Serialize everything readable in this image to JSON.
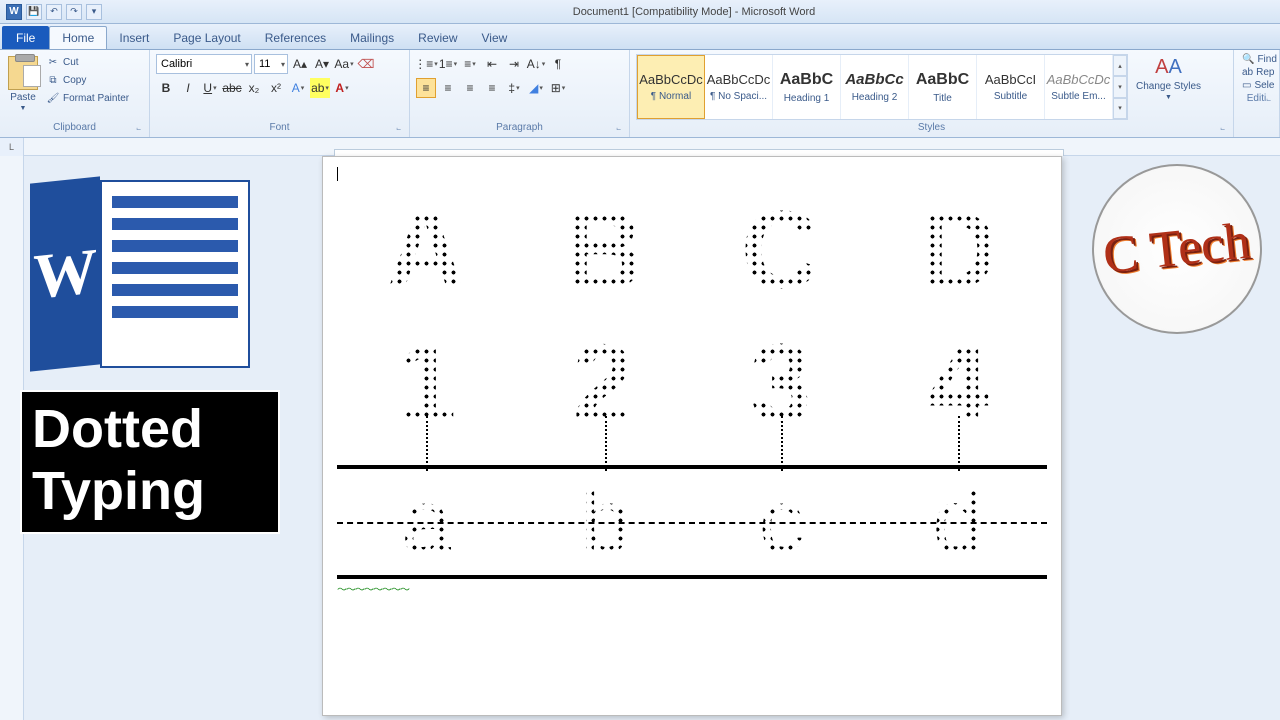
{
  "titlebar": {
    "title": "Document1 [Compatibility Mode] - Microsoft Word"
  },
  "tabs": {
    "file": "File",
    "items": [
      "Home",
      "Insert",
      "Page Layout",
      "References",
      "Mailings",
      "Review",
      "View"
    ],
    "active": "Home"
  },
  "clipboard": {
    "paste": "Paste",
    "cut": "Cut",
    "copy": "Copy",
    "fmt": "Format Painter",
    "label": "Clipboard"
  },
  "font": {
    "name": "Calibri",
    "size": "11",
    "label": "Font"
  },
  "paragraph": {
    "label": "Paragraph"
  },
  "styles": {
    "label": "Styles",
    "items": [
      {
        "preview": "AaBbCcDc",
        "name": "¶ Normal",
        "sel": true
      },
      {
        "preview": "AaBbCcDc",
        "name": "¶ No Spaci..."
      },
      {
        "preview": "AaBbC",
        "name": "Heading 1",
        "bold": true
      },
      {
        "preview": "AaBbCc",
        "name": "Heading 2",
        "bold": true,
        "italic": true
      },
      {
        "preview": "AaBbC",
        "name": "Title",
        "bold": true
      },
      {
        "preview": "AaBbCcI",
        "name": "Subtitle"
      },
      {
        "preview": "AaBbCcDc",
        "name": "Subtle Em...",
        "italic": true,
        "grey": true
      }
    ],
    "change": "Change Styles"
  },
  "editing": {
    "find": "Find",
    "replace": "Rep",
    "select": "Sele",
    "label": "Editi"
  },
  "document": {
    "row1": [
      "A",
      "B",
      "C",
      "D"
    ],
    "row2": [
      "1",
      "2",
      "3",
      "4"
    ],
    "row3": [
      "a",
      "b",
      "c",
      "d"
    ]
  },
  "overlay": {
    "line1": "Dotted",
    "line2": "Typing",
    "badge": "C Tech"
  }
}
